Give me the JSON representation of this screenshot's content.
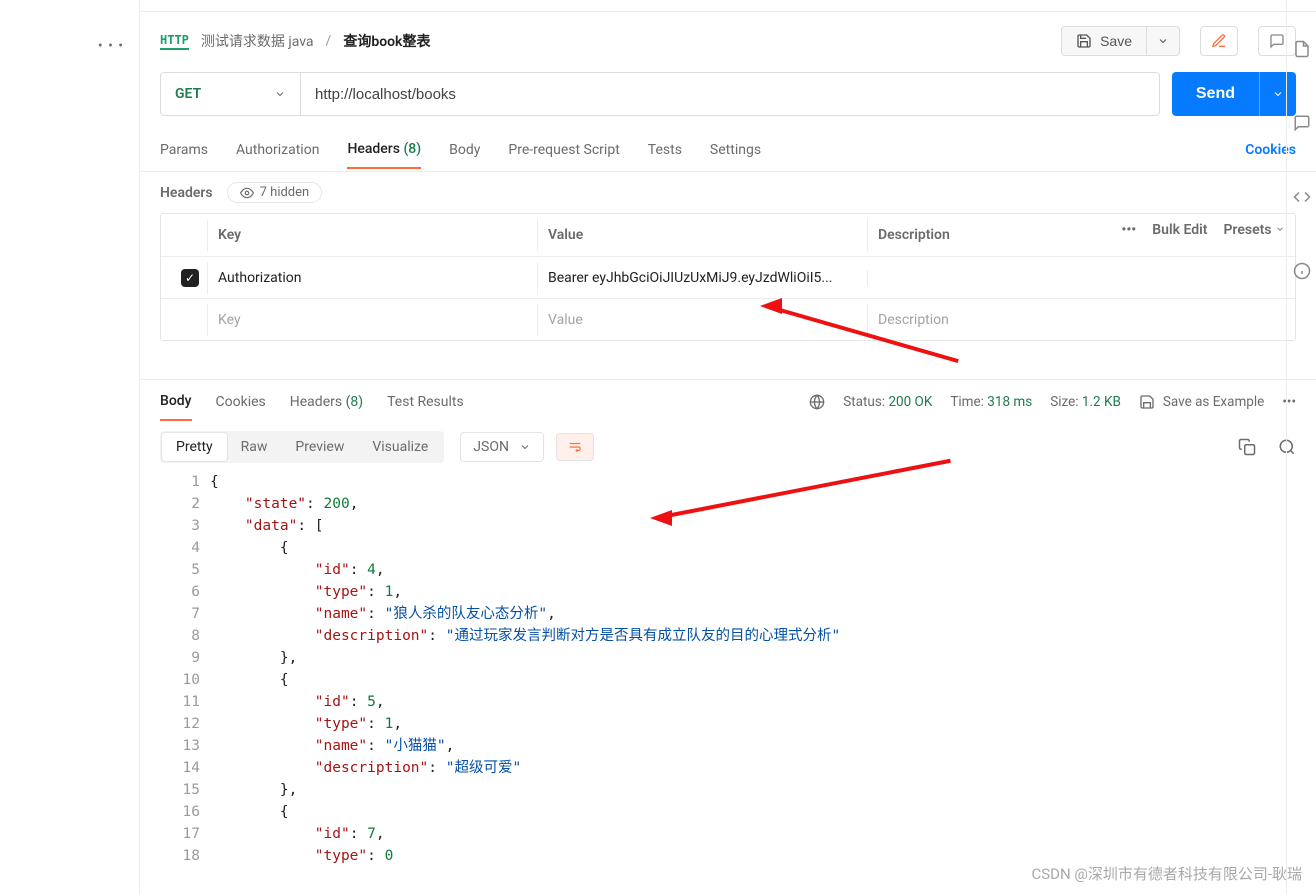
{
  "breadcrumb": {
    "collection": "测试请求数据 java",
    "request": "查询book整表"
  },
  "toolbar": {
    "save_label": "Save"
  },
  "request": {
    "method": "GET",
    "url": "http://localhost/books",
    "send_label": "Send"
  },
  "reqTabs": {
    "params": "Params",
    "authorization": "Authorization",
    "headers": "Headers",
    "headers_count": "(8)",
    "body": "Body",
    "prerequest": "Pre-request Script",
    "tests": "Tests",
    "settings": "Settings",
    "cookies": "Cookies"
  },
  "headersSection": {
    "title": "Headers",
    "hidden_label": "7 hidden",
    "col_key": "Key",
    "col_value": "Value",
    "col_desc": "Description",
    "bulk_edit": "Bulk Edit",
    "presets": "Presets",
    "row": {
      "key": "Authorization",
      "value": "Bearer eyJhbGciOiJIUzUxMiJ9.eyJzdWliOiI5..."
    },
    "placeholder": {
      "key": "Key",
      "value": "Value",
      "description": "Description"
    }
  },
  "respTabs": {
    "body": "Body",
    "cookies": "Cookies",
    "headers": "Headers",
    "headers_count": "(8)",
    "tests": "Test Results"
  },
  "respMeta": {
    "status_label": "Status:",
    "status_value": "200 OK",
    "time_label": "Time:",
    "time_value": "318 ms",
    "size_label": "Size:",
    "size_value": "1.2 KB",
    "save_example": "Save as Example"
  },
  "viewbar": {
    "pretty": "Pretty",
    "raw": "Raw",
    "preview": "Preview",
    "visualize": "Visualize",
    "format": "JSON"
  },
  "responseBody": {
    "state": 200,
    "data": [
      {
        "id": 4,
        "type": 1,
        "name": "狼人杀的队友心态分析",
        "description": "通过玩家发言判断对方是否具有成立队友的目的心理式分析"
      },
      {
        "id": 5,
        "type": 1,
        "name": "小猫猫",
        "description": "超级可爱"
      },
      {
        "id": 7,
        "type": 0
      }
    ]
  },
  "watermark": "CSDN @深圳市有德者科技有限公司-耿瑞"
}
